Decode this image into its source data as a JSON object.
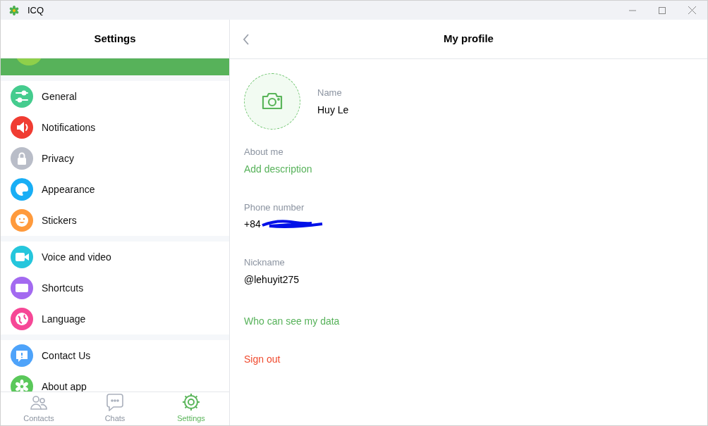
{
  "window": {
    "title": "ICQ"
  },
  "sidebar": {
    "title": "Settings",
    "groups": [
      [
        {
          "label": "General",
          "color": "#45cc8e"
        },
        {
          "label": "Notifications",
          "color": "#f03c32"
        },
        {
          "label": "Privacy",
          "color": "#b9bdc8"
        },
        {
          "label": "Appearance",
          "color": "#18aef5"
        },
        {
          "label": "Stickers",
          "color": "#ff9a3c"
        }
      ],
      [
        {
          "label": "Voice and video",
          "color": "#25c6dc"
        },
        {
          "label": "Shortcuts",
          "color": "#a36af0"
        },
        {
          "label": "Language",
          "color": "#f64796"
        }
      ],
      [
        {
          "label": "Contact Us",
          "color": "#4ea3fa"
        },
        {
          "label": "About app",
          "color": "#5ac85a"
        }
      ]
    ]
  },
  "nav": [
    {
      "label": "Contacts",
      "selected": false
    },
    {
      "label": "Chats",
      "selected": false
    },
    {
      "label": "Settings",
      "selected": true
    }
  ],
  "profile": {
    "title": "My profile",
    "name_label": "Name",
    "name": "Huy Le",
    "about_label": "About me",
    "about_link": "Add description",
    "phone_label": "Phone number",
    "phone": "+84",
    "nickname_label": "Nickname",
    "nickname": "@lehuyit275",
    "privacy_link": "Who can see my data",
    "sign_out": "Sign out"
  }
}
